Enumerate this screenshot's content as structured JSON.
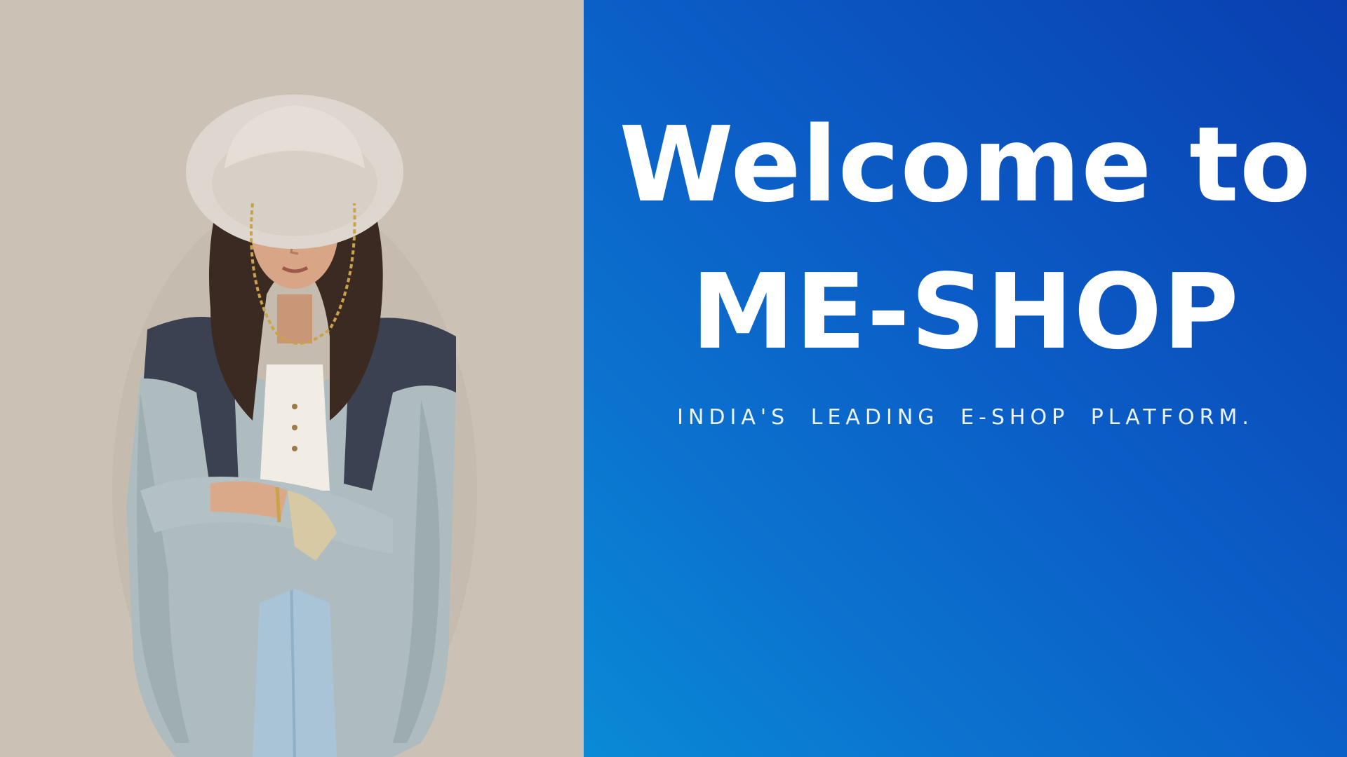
{
  "hero": {
    "title_line_1": "Welcome to",
    "title_line_2": "ME-SHOP",
    "tagline": "INDIA'S LEADING E-SHOP PLATFORM."
  },
  "photo": {
    "subject": "model-photo"
  },
  "colors": {
    "hero_gradient_dark": "#0a3fb0",
    "hero_gradient_light": "#0a8ad6",
    "photo_background": "#cdc4b8",
    "text": "#ffffff"
  }
}
